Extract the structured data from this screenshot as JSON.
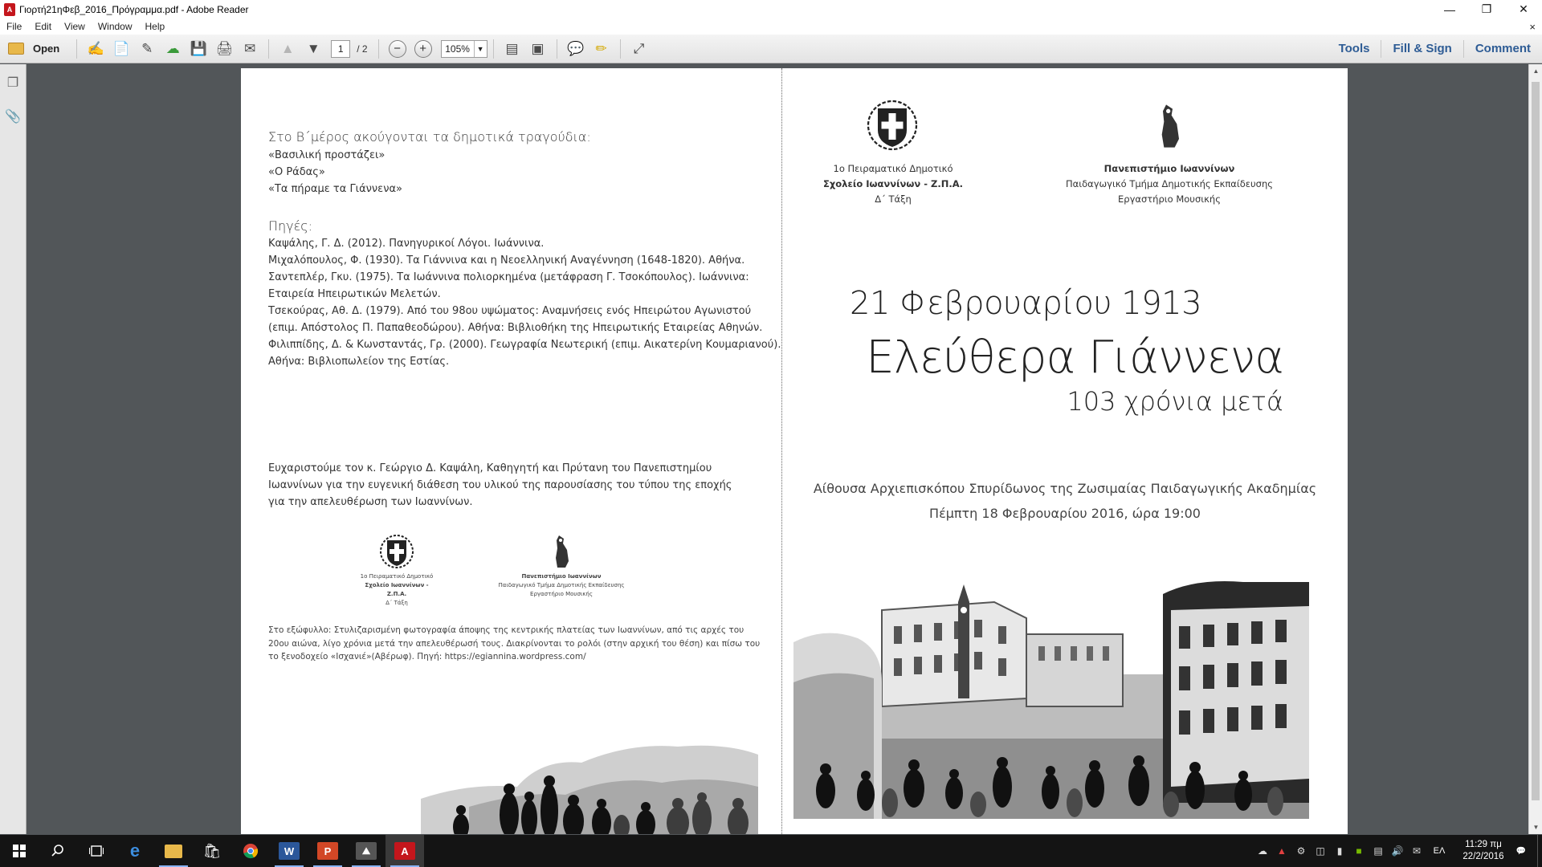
{
  "window": {
    "app_icon": "acrobat-reader-icon",
    "title": "Γιορτή21ηΦεβ_2016_Πρόγραμμα.pdf - Adobe Reader"
  },
  "menu": {
    "items": [
      "File",
      "Edit",
      "View",
      "Window",
      "Help"
    ],
    "close_glyph": "×"
  },
  "toolbar": {
    "open_label": "Open",
    "page_current": "1",
    "page_total": "/ 2",
    "zoom_value": "105%",
    "right_links": [
      "Tools",
      "Fill & Sign",
      "Comment"
    ]
  },
  "document": {
    "left": {
      "songs_heading": "Στο Β΄μέρος ακούγονται τα δημοτικά τραγούδια:",
      "songs": [
        "«Βασιλική προστάζει»",
        "«Ο Ράδας»",
        "«Τα πήραμε τα Γιάννενα»"
      ],
      "sources_heading": "Πηγές:",
      "sources": [
        "Καψάλης, Γ. Δ. (2012). Πανηγυρικοί Λόγοι. Ιωάννινα.",
        "Μιχαλόπουλος, Φ. (1930). Τα Γιάννινα και η Νεοελληνική Αναγέννηση (1648-1820). Αθήνα.",
        "Σαντεπλέρ, Γκυ. (1975). Τα Ιωάννινα πολιορκημένα (μετάφραση Γ. Τσοκόπουλος). Ιωάννινα:",
        "Εταιρεία Ηπειρωτικών Μελετών.",
        "Τσεκούρας, Αθ. Δ. (1979). Από του 98ου υψώματος: Αναμνήσεις ενός Ηπειρώτου Αγωνιστού",
        "(επιμ. Απόστολος Π. Παπαθεοδώρου). Αθήνα: Βιβλιοθήκη της Ηπειρωτικής Εταιρείας Αθηνών.",
        "Φιλιππίδης, Δ. & Κωνσταντάς, Γρ. (2000). Γεωγραφία Νεωτερική (επιμ. Αικατερίνη Κουμαριανού).",
        "Αθήνα: Βιβλιοπωλείον της Εστίας."
      ],
      "thanks": "Ευχαριστούμε τον κ. Γεώργιο Δ. Καψάλη, Καθηγητή και Πρύτανη του Πανεπιστημίου Ιωαννίνων για την ευγενική διάθεση του υλικού της παρουσίασης του τύπου της εποχής για την απελευθέρωση των Ιωαννίνων.",
      "school_logo_lines": [
        "1ο Πειραματικό Δημοτικό",
        "Σχολείο Ιωαννίνων - Ζ.Π.Α.",
        "Δ΄ Τάξη"
      ],
      "univ_logo_lines": [
        "Πανεπιστήμιο Ιωαννίνων",
        "Παιδαγωγικό Τμήμα Δημοτικής Εκπαίδευσης",
        "Εργαστήριο Μουσικής"
      ],
      "caption": "Στο εξώφυλλο: Στυλιζαρισμένη φωτογραφία άποψης της κεντρικής πλατείας των Ιωαννίνων, από τις αρχές του 20ου αιώνα, λίγο χρόνια μετά την απελευθέρωσή τους. Διακρίνονται το ρολόι (στην αρχική του θέση) και πίσω του το ξενοδοχείο «Ισχανιέ»(Αβέρωφ). Πηγή: https://egiannina.wordpress.com/"
    },
    "right": {
      "school_logo_lines": [
        "1ο Πειραματικό Δημοτικό",
        "Σχολείο Ιωαννίνων - Ζ.Π.Α.",
        "Δ΄ Τάξη"
      ],
      "univ_logo_lines": [
        "Πανεπιστήμιο Ιωαννίνων",
        "Παιδαγωγικό Τμήμα Δημοτικής Εκπαίδευσης",
        "Εργαστήριο Μουσικής"
      ],
      "date": "21 Φεβρουαρίου 1913",
      "title": "Ελεύθερα Γιάννενα",
      "subtitle": "103 χρόνια μετά",
      "venue": "Αίθουσα Αρχιεπισκόπου Σπυρίδωνος της Ζωσιμαίας Παιδαγωγικής Ακαδημίας",
      "when": "Πέμπτη 18 Φεβρουαρίου 2016, ώρα 19:00"
    }
  },
  "taskbar": {
    "apps": [
      "windows-start-icon",
      "search-icon",
      "task-view-icon",
      "edge-icon",
      "file-explorer-icon",
      "store-icon",
      "chrome-icon",
      "word-icon",
      "powerpoint-icon",
      "photos-icon",
      "acrobat-icon"
    ],
    "language": "ΕΛ",
    "time": "11:29 πμ",
    "date": "22/2/2016"
  }
}
